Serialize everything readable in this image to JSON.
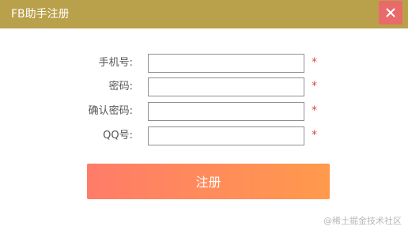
{
  "window": {
    "title": "FB助手注册",
    "close_icon": "close-icon"
  },
  "colors": {
    "titlebar": "#b9a04b",
    "close_button": "#e96a6a",
    "required_mark": "#e0473e",
    "button_gradient_start": "#ff7c69",
    "button_gradient_end": "#ff9a4c"
  },
  "form": {
    "fields": [
      {
        "label": "手机号:",
        "value": "",
        "required_mark": "*"
      },
      {
        "label": "密码:",
        "value": "",
        "required_mark": "*"
      },
      {
        "label": "确认密码:",
        "value": "",
        "required_mark": "*"
      },
      {
        "label": "QQ号:",
        "value": "",
        "required_mark": "*"
      }
    ],
    "submit_label": "注册"
  },
  "watermark": "@稀土掘金技术社区"
}
